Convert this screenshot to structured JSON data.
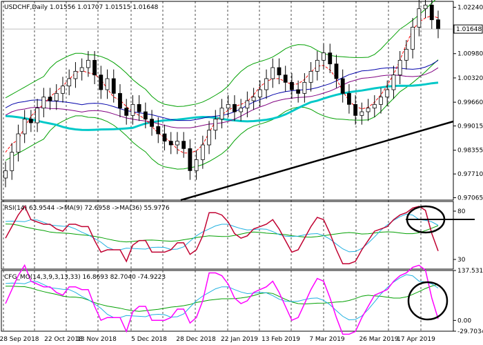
{
  "header": {
    "symbol": "USDCHF,Daily",
    "ohlc": "1.01556 1.01707 1.01515 1.01648"
  },
  "price_panel": {
    "y_ticks": [
      "1.02240",
      "1.00980",
      "1.00320",
      "0.99660",
      "0.99015",
      "0.98355",
      "0.97710",
      "0.97065"
    ],
    "current_price": "1.01648"
  },
  "rsi_panel": {
    "label": "RSI(14) 63.9544 ->MA(9) 72.6958 ->MA(36) 55.9776",
    "y_ticks": [
      "80",
      "30"
    ]
  },
  "osc_panel": {
    "label": "CFG_MO(14,3,9,3,13,33) 16.8693 82.7040 -74.9223",
    "y_ticks": [
      "137.5319",
      "0.00",
      "-29.7034"
    ]
  },
  "x_axis": {
    "labels": [
      "28 Sep 2018",
      "22 Oct 2018",
      "13 Nov 2018",
      "5 Dec 2018",
      "28 Dec 2018",
      "22 Jan 2019",
      "13 Feb 2019",
      "7 Mar 2019",
      "26 Mar 2019",
      "17 Apr 2019"
    ]
  },
  "colors": {
    "candle": "#000000",
    "ma_fast": "#ff0000",
    "ma_mid": "#0000aa",
    "ma_slow": "#800080",
    "ma_long": "#00c8c8",
    "bollinger": "#00a000",
    "rsi": "#c00030",
    "rsi_ma_fast": "#20b0e0",
    "rsi_ma_slow": "#00a000",
    "mo": "#ff00ff",
    "mo_sig1": "#20b0e0",
    "mo_sig2": "#00a000",
    "trendline": "#000000"
  },
  "chart_data": {
    "type": "candlestick",
    "x_labels": [
      "28 Sep 2018",
      "22 Oct 2018",
      "13 Nov 2018",
      "5 Dec 2018",
      "28 Dec 2018",
      "22 Jan 2019",
      "13 Feb 2019",
      "7 Mar 2019",
      "26 Mar 2019",
      "17 Apr 2019"
    ],
    "close": [
      0.978,
      0.983,
      0.988,
      0.992,
      0.991,
      0.995,
      0.998,
      0.997,
      0.999,
      1.001,
      1.003,
      1.005,
      1.006,
      1.008,
      1.004,
      1.0,
      1.003,
      0.999,
      0.995,
      0.993,
      0.996,
      0.994,
      0.992,
      0.99,
      0.988,
      0.986,
      0.985,
      0.986,
      0.984,
      0.978,
      0.981,
      0.985,
      0.989,
      0.992,
      0.995,
      0.996,
      0.994,
      0.995,
      0.997,
      0.998,
      1.0,
      1.003,
      1.006,
      1.004,
      1.002,
      1.0,
      0.999,
      1.002,
      1.005,
      1.008,
      1.01,
      1.007,
      1.003,
      0.999,
      0.996,
      0.993,
      0.994,
      0.995,
      0.996,
      0.998,
      1.0,
      1.004,
      1.008,
      1.011,
      1.017,
      1.022,
      1.023,
      1.019,
      1.0165
    ],
    "ylim": [
      0.97,
      1.024
    ],
    "rsi_ylim": [
      20,
      90
    ],
    "mo_ylim": [
      -29.7034,
      137.5319
    ]
  }
}
